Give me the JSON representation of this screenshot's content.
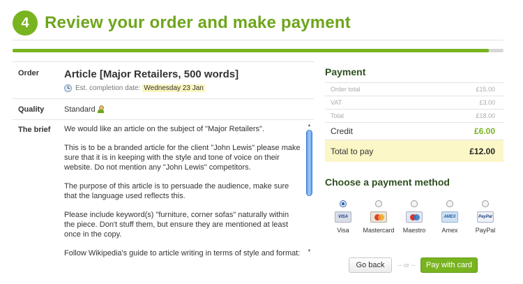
{
  "header": {
    "step_number": "4",
    "title": "Review your order and make payment",
    "progress_percent": 97
  },
  "order": {
    "label": "Order",
    "title": "Article [Major Retailers, 500 words]",
    "est_label": "Est. completion date:",
    "est_date": "Wednesday 23 Jan"
  },
  "quality": {
    "label": "Quality",
    "value": "Standard"
  },
  "brief": {
    "label": "The brief",
    "paragraphs": [
      "We would like an article on the subject of \"Major Retailers\".",
      "This is to be a branded article for the client \"John Lewis\" please make sure that it is in keeping with the style and tone of voice on their website. Do not mention any \"John Lewis\" competitors.",
      "The purpose of this article is to persuade the audience, make sure that the language used reflects this.",
      "Please include keyword(s) \"furniture, corner sofas\" naturally within the piece. Don't stuff them, but ensure they are mentioned at least once in the copy.",
      "Follow Wikipedia's guide to article writing in terms of style and format: http://en.wikipedia.org/wiki/Wikipedia:Writing_better_articles"
    ]
  },
  "payment": {
    "heading": "Payment",
    "rows": [
      {
        "label": "Order total",
        "amount": "£15.00"
      },
      {
        "label": "VAT",
        "amount": "£3.00"
      },
      {
        "label": "Total",
        "amount": "£18.00"
      }
    ],
    "credit": {
      "label": "Credit",
      "amount": "£6.00"
    },
    "total_to_pay": {
      "label": "Total to pay",
      "amount": "£12.00"
    }
  },
  "methods": {
    "heading": "Choose a payment method",
    "options": [
      {
        "name": "Visa",
        "badge": "VISA",
        "selected": true
      },
      {
        "name": "Mastercard",
        "badge": "",
        "selected": false
      },
      {
        "name": "Maestro",
        "badge": "",
        "selected": false
      },
      {
        "name": "Amex",
        "badge": "AMEX",
        "selected": false
      },
      {
        "name": "PayPal",
        "badge": "PayPal",
        "selected": false
      }
    ]
  },
  "actions": {
    "back_label": "Go back",
    "or_label": "-- or --",
    "pay_label": "Pay with card"
  },
  "colors": {
    "brand_green": "#78b41f",
    "highlight_yellow": "#fcf7c6",
    "heading_dark_green": "#2f4f1f"
  }
}
